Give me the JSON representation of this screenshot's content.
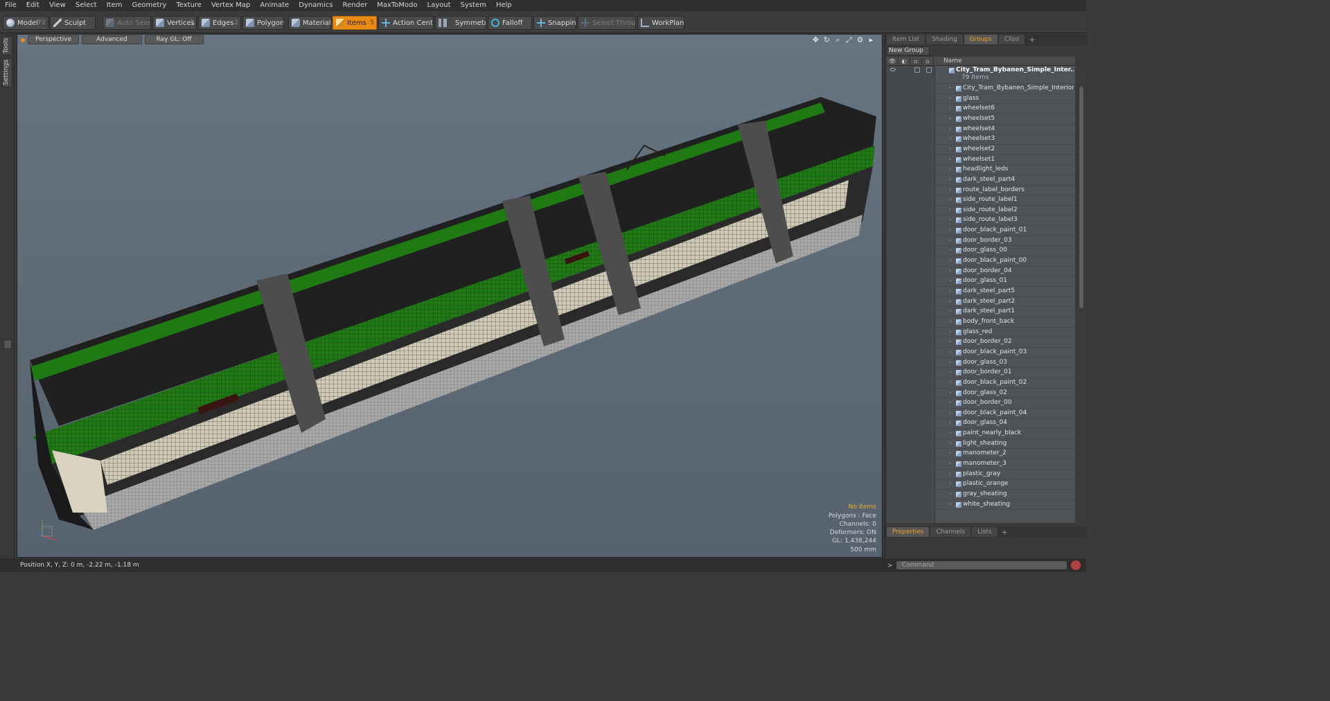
{
  "menu": [
    "File",
    "Edit",
    "View",
    "Select",
    "Item",
    "Geometry",
    "Texture",
    "Vertex Map",
    "Animate",
    "Dynamics",
    "Render",
    "MaxToModo",
    "Layout",
    "System",
    "Help"
  ],
  "toolbar": {
    "model": "Model",
    "model_key": "F2",
    "sculpt": "Sculpt",
    "auto_select": "Auto Select",
    "vertices": "Vertices",
    "vertices_key": "1",
    "edges": "Edges",
    "edges_key": "2",
    "polygons": "Polygons",
    "materials": "Materials",
    "items": "Items",
    "items_key": "5",
    "action_center": "Action Center",
    "symmetry": "Symmetry",
    "falloff": "Falloff",
    "snapping": "Snapping",
    "select_through": "Select Through",
    "workplane": "WorkPlane"
  },
  "left_tabs": [
    "Tools",
    "Settings"
  ],
  "viewport": {
    "view": "Perspective",
    "shading": "Advanced",
    "raygl": "Ray GL: Off",
    "info": {
      "items": "No Items",
      "polygons": "Polygons : Face",
      "channels": "Channels: 0",
      "deformers": "Deformers: ON",
      "gl": "GL: 1,438,244",
      "scale": "500 mm"
    },
    "colors": {
      "tram_green": "#1f7a14",
      "warning": "#f0b02d"
    }
  },
  "panel_tabs": [
    "Item List",
    "Shading",
    "Groups",
    "Clips"
  ],
  "panel_active": "Groups",
  "new_group": "New Group",
  "tree_header": "Name",
  "root": {
    "name": "City_Tram_Bybanen_Simple_Inter...",
    "count": "79 Items"
  },
  "items": [
    "City_Tram_Bybanen_Simple_Interior_...",
    "glass",
    "wheelset6",
    "wheelset5",
    "wheelset4",
    "wheelset3",
    "wheelset2",
    "wheelset1",
    "headlight_leds",
    "dark_steel_part4",
    "route_label_borders",
    "side_route_label1",
    "side_route_label2",
    "side_route_label3",
    "door_black_paint_01",
    "door_border_03",
    "door_glass_00",
    "door_black_paint_00",
    "door_border_04",
    "door_glass_01",
    "dark_steel_part5",
    "dark_steel_part2",
    "dark_steel_part1",
    "body_front_back",
    "glass_red",
    "door_border_02",
    "door_black_paint_03",
    "door_glass_03",
    "door_border_01",
    "door_black_paint_02",
    "door_glass_02",
    "door_border_00",
    "door_black_paint_04",
    "door_glass_04",
    "paint_nearly_black",
    "light_sheating",
    "manometer_2",
    "manometer_3",
    "plastic_gray",
    "plastic_orange",
    "gray_sheating",
    "white_sheating"
  ],
  "bottom_tabs": [
    "Properties",
    "Channels",
    "Lists"
  ],
  "bottom_active": "Properties",
  "status": "Position X, Y, Z:  0 m, -2.22 m, -1.18 m",
  "command_placeholder": "Command"
}
